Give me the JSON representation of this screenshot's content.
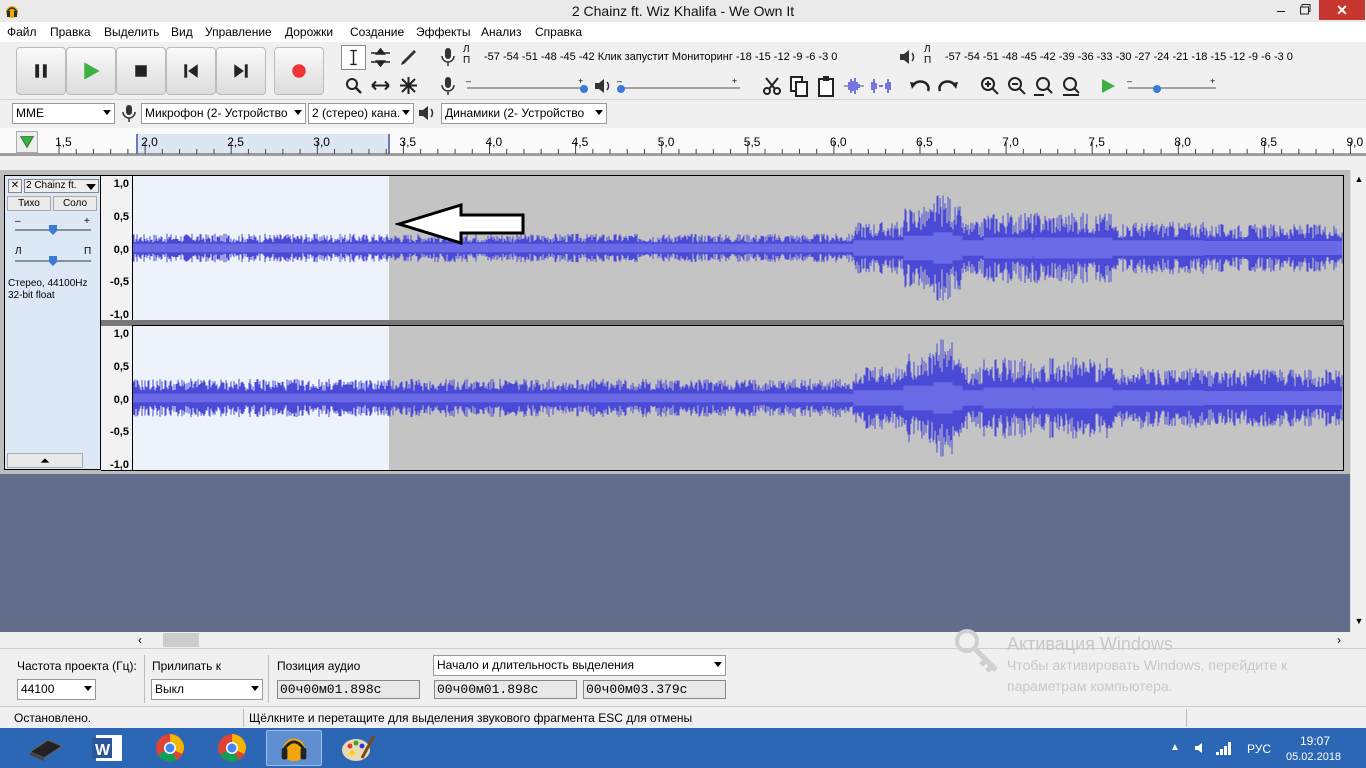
{
  "window": {
    "title": "2 Chainz ft. Wiz Khalifa - We Own It"
  },
  "menu": [
    "Файл",
    "Правка",
    "Выделить",
    "Вид",
    "Управление",
    "Дорожки",
    "Создание",
    "Эффекты",
    "Анализ",
    "Справка"
  ],
  "meters": {
    "record_scale": "-57 -54 -51 -48 -45 -42 Клик запустит Мониторинг -18 -15 -12  -9  -6  -3  0",
    "play_scale": "-57 -54 -51 -48 -45 -42 -39 -36 -33 -30 -27 -24 -21 -18 -15 -12  -9  -6  -3  0",
    "lp": "Л\nП"
  },
  "devices": {
    "host": "MME",
    "mic": "Микрофон (2- Устройство",
    "channels": "2 (стерео) кана.",
    "speakers": "Динамики (2- Устройство"
  },
  "ruler": {
    "ticks": [
      "1,5",
      "2,0",
      "2,5",
      "3,0",
      "3,5",
      "4,0",
      "4,5",
      "5,0",
      "5,5",
      "6,0",
      "6,5",
      "7,0",
      "7,5",
      "8,0",
      "8,5",
      "9,0"
    ]
  },
  "track": {
    "name": "2 Chainz ft.",
    "mute": "Тихо",
    "solo": "Соло",
    "gain_minus": "–",
    "gain_plus": "+",
    "pan_l": "Л",
    "pan_r": "П",
    "info1": "Стерео, 44100Hz",
    "info2": "32-bit float",
    "axis": [
      "1,0",
      "0,5",
      "0,0",
      "-0,5",
      "-1,0"
    ],
    "selection_fraction": 0.21
  },
  "bottom": {
    "rate_label": "Частота проекта (Гц):",
    "rate_value": "44100",
    "snap_label": "Прилипать к",
    "snap_value": "Выкл",
    "pos_label": "Позиция аудио",
    "sel_mode": "Начало и длительность выделения",
    "pos_time": "00ч00м01.898с",
    "sel_start": "00ч00м01.898с",
    "sel_len": "00ч00м03.379с"
  },
  "status": {
    "left": "Остановлено.",
    "hint": "Щёлкните и перетащите для выделения звукового фрагмента ESC для отмены"
  },
  "watermark": {
    "line1": "Активация Windows",
    "line2": "Чтобы активировать Windows, перейдите к",
    "line3": "параметрам компьютера."
  },
  "tray": {
    "lang": "РУС",
    "time": "19:07",
    "date": "05.02.2018"
  },
  "colors": {
    "wave": "#4a4ad6",
    "selection": "#edf2fb",
    "background": "#626d8c",
    "taskbar": "#2b67b5"
  },
  "taskbar_icons": [
    "keyboard-app-icon",
    "word-icon",
    "chrome-icon",
    "chrome-icon",
    "audacity-icon",
    "paint-icon"
  ]
}
